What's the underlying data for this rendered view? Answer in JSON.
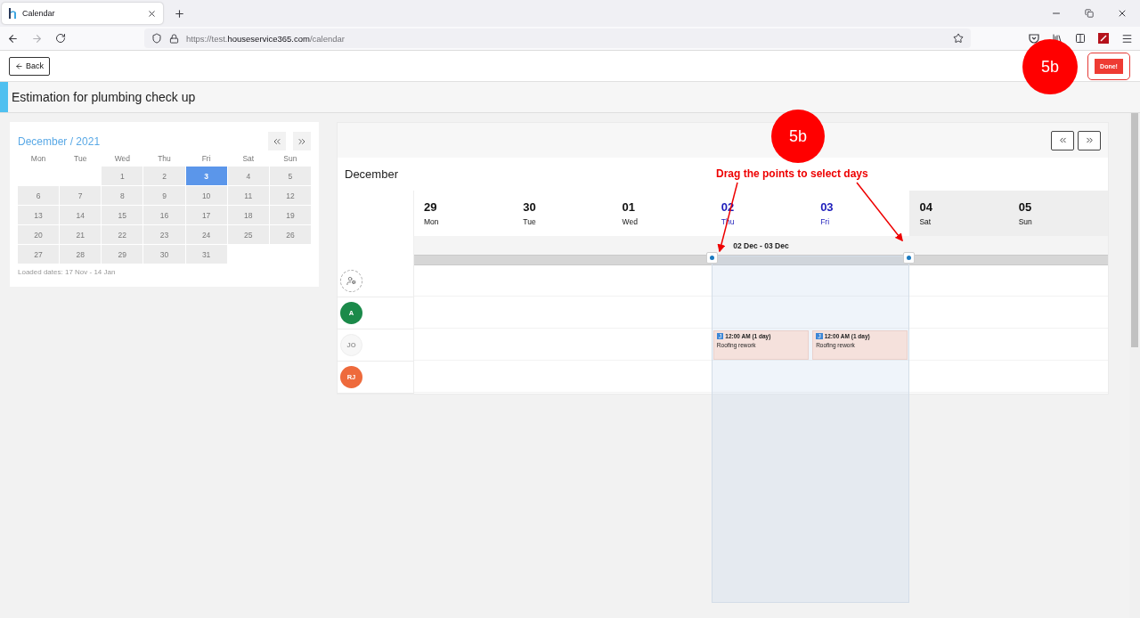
{
  "browser": {
    "tab_title": "Calendar",
    "url_scheme": "https://test.",
    "url_domain": "houseservice365.com",
    "url_path": "/calendar"
  },
  "header": {
    "back_label": "Back",
    "done_label": "Done!"
  },
  "page_title": "Estimation for plumbing check up",
  "mini_calendar": {
    "title": "December / 2021",
    "weekdays": [
      "Mon",
      "Tue",
      "Wed",
      "Thu",
      "Fri",
      "Sat",
      "Sun"
    ],
    "weeks": [
      [
        {
          "kind": "blank"
        },
        {
          "kind": "blank"
        },
        {
          "day": "1",
          "selected": false
        },
        {
          "day": "2",
          "selected": false
        },
        {
          "day": "3",
          "selected": true
        },
        {
          "day": "4",
          "selected": false
        },
        {
          "day": "5",
          "selected": false
        }
      ],
      [
        {
          "day": "6",
          "selected": false
        },
        {
          "day": "7",
          "selected": false
        },
        {
          "day": "8",
          "selected": false
        },
        {
          "day": "9",
          "selected": false
        },
        {
          "day": "10",
          "selected": false
        },
        {
          "day": "11",
          "selected": false
        },
        {
          "day": "12",
          "selected": false
        }
      ],
      [
        {
          "day": "13",
          "selected": false
        },
        {
          "day": "14",
          "selected": false
        },
        {
          "day": "15",
          "selected": false
        },
        {
          "day": "16",
          "selected": false
        },
        {
          "day": "17",
          "selected": false
        },
        {
          "day": "18",
          "selected": false
        },
        {
          "day": "19",
          "selected": false
        }
      ],
      [
        {
          "day": "20",
          "selected": false
        },
        {
          "day": "21",
          "selected": false
        },
        {
          "day": "22",
          "selected": false
        },
        {
          "day": "23",
          "selected": false
        },
        {
          "day": "24",
          "selected": false
        },
        {
          "day": "25",
          "selected": false
        },
        {
          "day": "26",
          "selected": false
        }
      ],
      [
        {
          "day": "27",
          "selected": false
        },
        {
          "day": "28",
          "selected": false
        },
        {
          "day": "29",
          "selected": false
        },
        {
          "day": "30",
          "selected": false
        },
        {
          "day": "31",
          "selected": false
        },
        {
          "kind": "blank"
        },
        {
          "kind": "blank"
        }
      ]
    ],
    "loaded_label": "Loaded dates:",
    "loaded_range": "17 Nov - 14 Jan"
  },
  "scheduler": {
    "month": "December",
    "days": [
      {
        "date": "29",
        "weekday": "Mon",
        "selected": false,
        "weekend": false
      },
      {
        "date": "30",
        "weekday": "Tue",
        "selected": false,
        "weekend": false
      },
      {
        "date": "01",
        "weekday": "Wed",
        "selected": false,
        "weekend": false
      },
      {
        "date": "02",
        "weekday": "Thu",
        "selected": true,
        "weekend": false
      },
      {
        "date": "03",
        "weekday": "Fri",
        "selected": true,
        "weekend": false
      },
      {
        "date": "04",
        "weekday": "Sat",
        "selected": false,
        "weekend": true
      },
      {
        "date": "05",
        "weekday": "Sun",
        "selected": false,
        "weekend": true
      }
    ],
    "range_label": "02 Dec - 03 Dec",
    "resources": [
      {
        "kind": "unassigned"
      },
      {
        "kind": "avatar",
        "initials": "A",
        "color": "#1b8a4a",
        "disabled": false
      },
      {
        "kind": "avatar",
        "initials": "JO",
        "color": "#f7f7f7",
        "disabled": true,
        "cells": [
          null,
          null,
          null,
          {
            "tag": "J",
            "time": "12:00 AM (1 day)",
            "title": "Roofing rework"
          },
          {
            "tag": "J",
            "time": "12:00 AM (1 day)",
            "title": "Roofing rework"
          },
          null,
          null
        ]
      },
      {
        "kind": "avatar",
        "initials": "RJ",
        "color": "#ee6a3c",
        "disabled": false
      }
    ]
  },
  "annotations": [
    {
      "kind": "badge",
      "text": "5b"
    },
    {
      "kind": "badge",
      "text": "5b"
    },
    {
      "kind": "callout",
      "text": "Drag the points to select days"
    }
  ]
}
